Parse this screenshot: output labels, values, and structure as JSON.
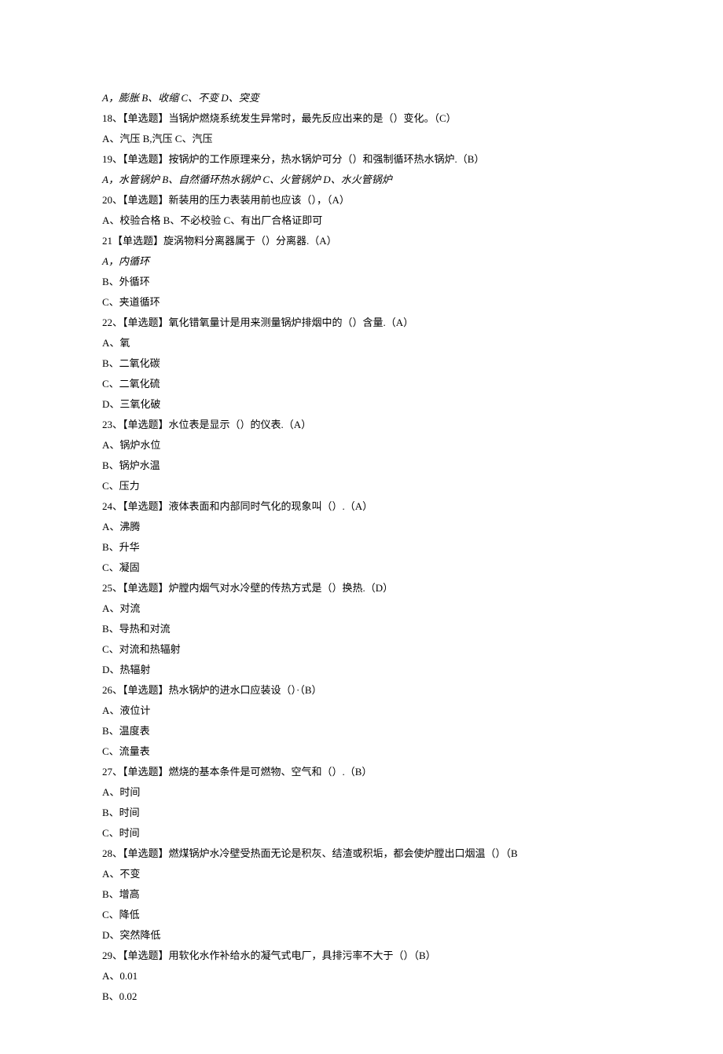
{
  "lines": [
    {
      "text": "A，膨胀 B、收缩 C、不变 D、突变",
      "italic": true
    },
    {
      "text": "18、【单选题】当锅炉燃烧系统发生异常时，最先反应出来的是（）变化。（C）"
    },
    {
      "text": "A、汽压 B,汽压 C、汽压"
    },
    {
      "text": "19、【单选题】按锅炉的工作原理来分，热水锅炉可分（）和强制循环热水锅炉.（B）"
    },
    {
      "text": "A，水管锅炉 B、自然循环热水锅炉 C、火管锅炉 D、水火管锅炉",
      "italic": true
    },
    {
      "text": "20、【单选题】新装用的压力表装用前也应该（），（A）"
    },
    {
      "text": "A、校验合格 B、不必校验 C、有出厂合格证即可"
    },
    {
      "text": "21【单选题】旋涡物料分离器属于（）分离器.（A）"
    },
    {
      "text": "A，内循环",
      "italic": true
    },
    {
      "text": "B、外循环"
    },
    {
      "text": "C、夹道循环"
    },
    {
      "text": "22、【单选题】氧化错氧量计是用来测量锅炉排烟中的（）含量.（A）"
    },
    {
      "text": "A、氧"
    },
    {
      "text": "B、二氧化碳"
    },
    {
      "text": "C、二氧化硫"
    },
    {
      "text": "D、三氧化破"
    },
    {
      "text": "23、【单选题】水位表是显示（）的仪表.（A）"
    },
    {
      "text": "A、锅炉水位"
    },
    {
      "text": "B、锅炉水温"
    },
    {
      "text": "C、压力"
    },
    {
      "text": "24、【单选题】液体表面和内部同时气化的现象叫（）.（A）"
    },
    {
      "text": "A、沸腾"
    },
    {
      "text": "B、升华"
    },
    {
      "text": "C、凝固"
    },
    {
      "text": "25、【单选题】炉膛内烟气对水冷壁的传热方式是（）换热.（D）"
    },
    {
      "text": "A、对流"
    },
    {
      "text": "B、导热和对流"
    },
    {
      "text": "C、对流和热辐射"
    },
    {
      "text": "D、热辐射"
    },
    {
      "text": "26、【单选题】热水锅炉的进水口应装设（）·（B）"
    },
    {
      "text": "A、液位计"
    },
    {
      "text": "B、温度表"
    },
    {
      "text": "C、流量表"
    },
    {
      "text": "27、【单选题】燃烧的基本条件是可燃物、空气和（）.（B）"
    },
    {
      "text": "A、时间"
    },
    {
      "text": "B、时间"
    },
    {
      "text": "C、时间"
    },
    {
      "text": "28、【单选题】燃煤锅炉水冷壁受热面无论是积灰、结渣或积垢，都会使炉膛出口烟温（）（B"
    },
    {
      "text": "A、不变"
    },
    {
      "text": "B、增高"
    },
    {
      "text": "C、降低"
    },
    {
      "text": "D、突然降低"
    },
    {
      "text": "29、【单选题】用软化水作补给水的凝气式电厂，具排污率不大于（）（B）"
    },
    {
      "text": "A、0.01"
    },
    {
      "text": "B、0.02"
    }
  ]
}
